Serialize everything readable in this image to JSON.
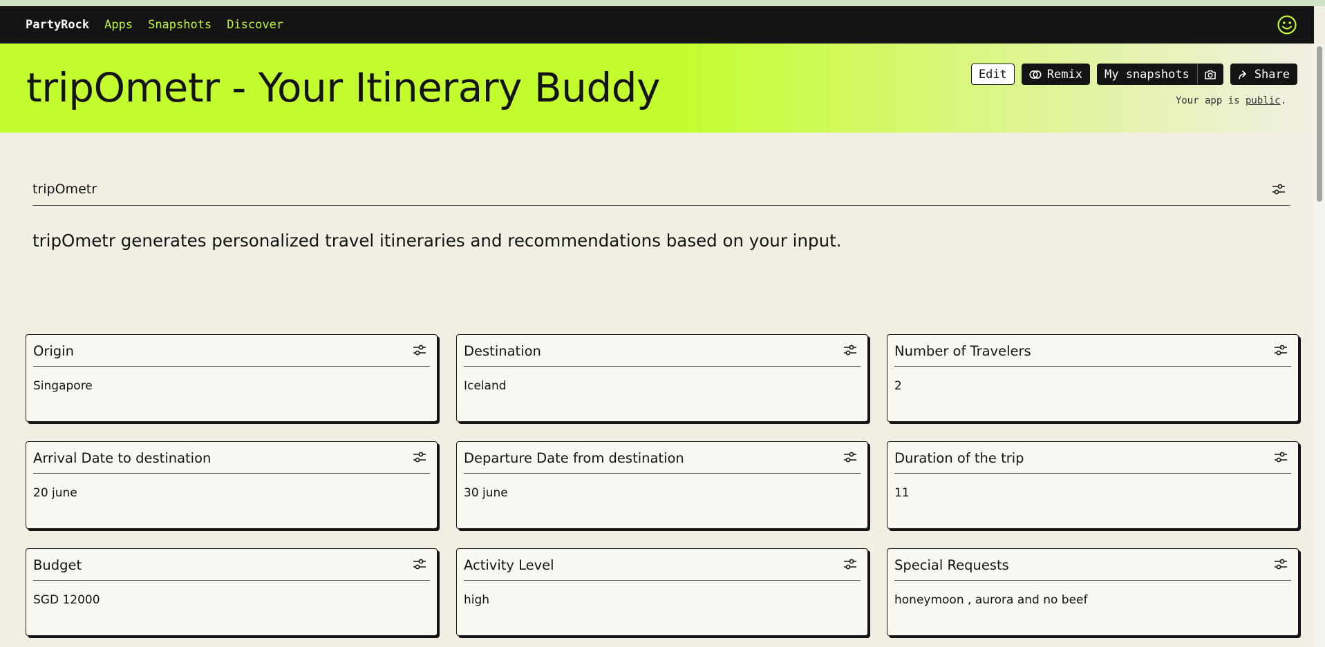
{
  "nav": {
    "logo": "PartyRock",
    "links": [
      "Apps",
      "Snapshots",
      "Discover"
    ],
    "profile_icon": "smiley-icon"
  },
  "header": {
    "title": "tripOmetr - Your Itinerary Buddy",
    "buttons": {
      "edit": "Edit",
      "remix": "Remix",
      "snapshots": "My snapshots",
      "share": "Share"
    },
    "visibility_prefix": "Your app is ",
    "visibility_link": "public",
    "visibility_suffix": "."
  },
  "app": {
    "name": "tripOmetr",
    "description": "tripOmetr generates personalized travel itineraries and recommendations based on your input."
  },
  "widgets": [
    {
      "title": "Origin",
      "value": "Singapore"
    },
    {
      "title": "Destination",
      "value": "Iceland"
    },
    {
      "title": "Number of Travelers",
      "value": "2"
    },
    {
      "title": "Arrival Date to destination",
      "value": "20 june"
    },
    {
      "title": "Departure Date from destination",
      "value": "30 june"
    },
    {
      "title": "Duration of the trip",
      "value": "11"
    },
    {
      "title": "Budget",
      "value": "SGD 12000"
    },
    {
      "title": "Activity Level",
      "value": "high"
    },
    {
      "title": "Special Requests",
      "value": "honeymoon , aurora and no beef"
    }
  ],
  "colors": {
    "accent": "#c3fd2f",
    "nav_link": "#c3f53a",
    "navbar_bg": "#141414",
    "page_bg": "#f1efe4"
  }
}
